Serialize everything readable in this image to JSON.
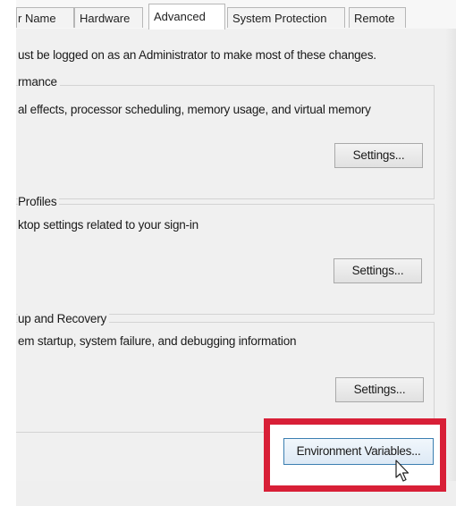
{
  "tabs": [
    {
      "label": "r Name"
    },
    {
      "label": "Hardware"
    },
    {
      "label": "Advanced",
      "active": true
    },
    {
      "label": "System Protection"
    },
    {
      "label": "Remote"
    }
  ],
  "notice": "ust be logged on as an Administrator to make most of these changes.",
  "performance": {
    "title": "rmance",
    "description": "al effects, processor scheduling, memory usage, and virtual memory",
    "settings_label": "Settings..."
  },
  "user_profiles": {
    "title": "Profiles",
    "description": "ktop settings related to your sign-in",
    "settings_label": "Settings..."
  },
  "startup_recovery": {
    "title": "up and Recovery",
    "description": "em startup, system failure, and debugging information",
    "settings_label": "Settings..."
  },
  "environment_variables_label": "Environment Variables...",
  "colors": {
    "highlight_border": "#d81f37",
    "focused_button_border": "#3c7fb1",
    "panel_background": "#f0f0f0"
  }
}
